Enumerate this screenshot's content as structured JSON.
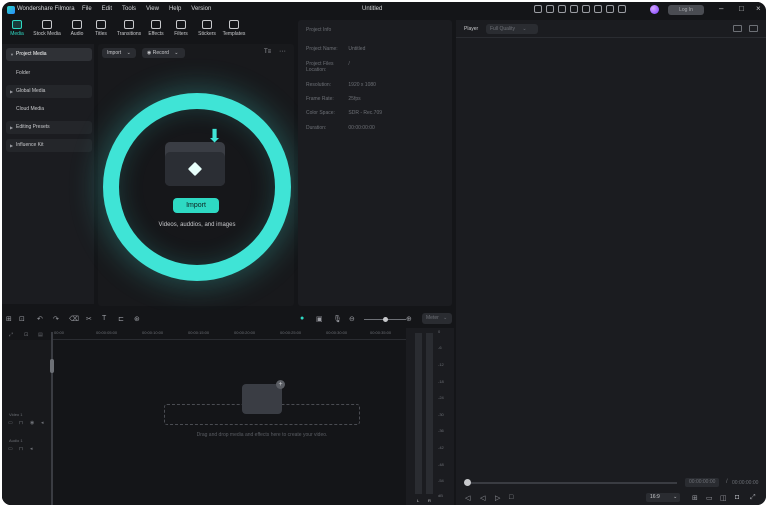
{
  "app": {
    "name": "Wondershare Filmora",
    "document_title": "Untitled",
    "login_label": "Log In",
    "menu": [
      "File",
      "Edit",
      "Tools",
      "View",
      "Help",
      "Version"
    ]
  },
  "toolbar": {
    "tools": [
      {
        "label": "Media",
        "icon": "media-icon",
        "active": true
      },
      {
        "label": "Stock Media",
        "icon": "stock-media-icon"
      },
      {
        "label": "Audio",
        "icon": "audio-icon"
      },
      {
        "label": "Titles",
        "icon": "titles-icon"
      },
      {
        "label": "Transitions",
        "icon": "transitions-icon"
      },
      {
        "label": "Effects",
        "icon": "effects-icon"
      },
      {
        "label": "Filters",
        "icon": "filters-icon"
      },
      {
        "label": "Stickers",
        "icon": "stickers-icon"
      },
      {
        "label": "Templates",
        "icon": "templates-icon"
      }
    ]
  },
  "sidebar": {
    "items": [
      {
        "label": "Project Media",
        "expanded": true
      },
      {
        "label": "Folder",
        "child": true
      },
      {
        "label": "Global Media"
      },
      {
        "label": "Cloud Media",
        "child": true
      },
      {
        "label": "Editing Presets"
      },
      {
        "label": "Influence Kit"
      }
    ]
  },
  "media": {
    "import_dropdown": "Import",
    "record_dropdown": "Record",
    "import_button": "Import",
    "import_subtitle": "Videos, auddios, and images"
  },
  "project_info": {
    "title": "Project Info",
    "rows": [
      {
        "key": "Project Name:",
        "value": "Untitled"
      },
      {
        "key": "Project Files Location:",
        "value": "/"
      },
      {
        "key": "Resolution:",
        "value": "1920 x 1080"
      },
      {
        "key": "Frame Rate:",
        "value": "25fps"
      },
      {
        "key": "Color Space:",
        "value": "SDR - Rec.709"
      },
      {
        "key": "Duration:",
        "value": "00:00:00:00"
      }
    ]
  },
  "player": {
    "label": "Player",
    "quality": "Full Quality",
    "current_time": "00:00:00:00",
    "separator": "/",
    "total_time": "00:00:00:00",
    "aspect_ratio": "16:9"
  },
  "timeline": {
    "meter_label": "Meter",
    "ruler": [
      "00:00",
      "00:00:05:00",
      "00:00:10:00",
      "00:00:15:00",
      "00:00:20:00",
      "00:00:25:00",
      "00:00:30:00",
      "00:00:35:00"
    ],
    "tracks": [
      {
        "label": "Video 1"
      },
      {
        "label": "Audio 1"
      }
    ],
    "drop_hint": "Drag and drop media and effects here to create your video.",
    "vu_scale": [
      "0",
      "-6",
      "-12",
      "-18",
      "-24",
      "-30",
      "-36",
      "-42",
      "-48",
      "-54",
      "dB"
    ],
    "channels": [
      "L",
      "R"
    ]
  }
}
